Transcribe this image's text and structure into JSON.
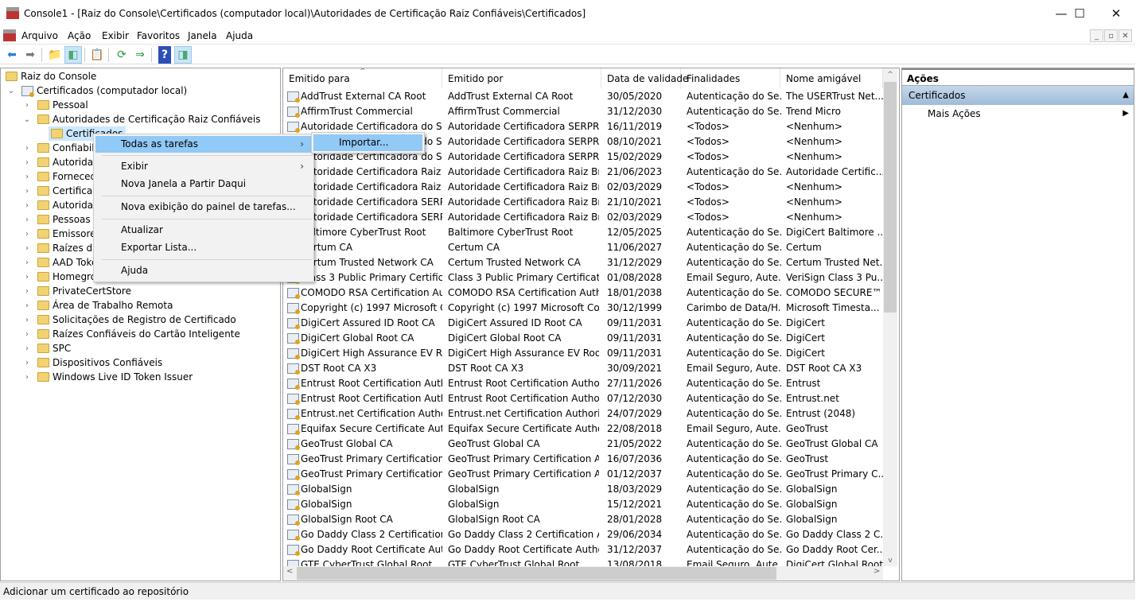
{
  "window": {
    "title": "Console1 - [Raiz do Console\\Certificados (computador local)\\Autoridades de Certificação Raiz Confiáveis\\Certificados]"
  },
  "menubar": [
    "Arquivo",
    "Ação",
    "Exibir",
    "Favoritos",
    "Janela",
    "Ajuda"
  ],
  "tree": {
    "root": "Raiz do Console",
    "computer": "Certificados (computador local)",
    "stores": [
      "Pessoal",
      "Autoridades de Certificação Raiz Confiáveis",
      "Confiabili",
      "Autoridad",
      "Fornecedo",
      "Certificad",
      "Autoridad",
      "Pessoas C",
      "Emissores",
      "Raízes da",
      "AAD Toke",
      "Homegro",
      "PrivateCertStore",
      "Área de Trabalho Remota",
      "Solicitações de Registro de Certificado",
      "Raízes Confiáveis do Cartão Inteligente",
      "SPC",
      "Dispositivos Confiáveis",
      "Windows Live ID Token Issuer"
    ],
    "selected": "Certificados"
  },
  "list": {
    "columns": [
      "Emitido para",
      "Emitido por",
      "Data de validade",
      "Finalidades",
      "Nome amigável"
    ],
    "rows": [
      [
        "AddTrust External CA Root",
        "AddTrust External CA Root",
        "30/05/2020",
        "Autenticação do Se...",
        "The USERTrust Net..."
      ],
      [
        "AffirmTrust Commercial",
        "AffirmTrust Commercial",
        "31/12/2030",
        "Autenticação do Se...",
        "Trend Micro"
      ],
      [
        "Autoridade Certificadora do SE...",
        "Autoridade Certificadora SERPRO ...",
        "16/11/2019",
        "<Todos>",
        "<Nenhum>"
      ],
      [
        "Autoridade Certificadora do SE...",
        "Autoridade Certificadora SERPRO ...",
        "08/10/2021",
        "<Todos>",
        "<Nenhum>"
      ],
      [
        "Autoridade Certificadora do SE...",
        "Autoridade Certificadora SERPRO ...",
        "15/02/2029",
        "<Todos>",
        "<Nenhum>"
      ],
      [
        "Autoridade Certificadora Raiz B...",
        "Autoridade Certificadora Raiz Bras...",
        "21/06/2023",
        "Autenticação do Se...",
        "Autoridade Certific..."
      ],
      [
        "Autoridade Certificadora Raiz B...",
        "Autoridade Certificadora Raiz Bras...",
        "02/03/2029",
        "<Todos>",
        "<Nenhum>"
      ],
      [
        "Autoridade Certificadora SERPR...",
        "Autoridade Certificadora Raiz Bras...",
        "21/10/2021",
        "<Todos>",
        "<Nenhum>"
      ],
      [
        "Autoridade Certificadora SERPR...",
        "Autoridade Certificadora Raiz Bras...",
        "02/03/2029",
        "<Todos>",
        "<Nenhum>"
      ],
      [
        "Baltimore CyberTrust Root",
        "Baltimore CyberTrust Root",
        "12/05/2025",
        "Autenticação do Se...",
        "DigiCert Baltimore ..."
      ],
      [
        "Certum CA",
        "Certum CA",
        "11/06/2027",
        "Autenticação do Se...",
        "Certum"
      ],
      [
        "Certum Trusted Network CA",
        "Certum Trusted Network CA",
        "31/12/2029",
        "Autenticação do Se...",
        "Certum Trusted Net..."
      ],
      [
        "Class 3 Public Primary Certificat...",
        "Class 3 Public Primary Certificatio...",
        "01/08/2028",
        "Email Seguro, Aute...",
        "VeriSign Class 3 Pu..."
      ],
      [
        "COMODO RSA Certification Au...",
        "COMODO RSA Certification Auth...",
        "18/01/2038",
        "Autenticação do Se...",
        "COMODO SECURE™"
      ],
      [
        "Copyright (c) 1997 Microsoft C...",
        "Copyright (c) 1997 Microsoft Corp.",
        "30/12/1999",
        "Carimbo de Data/H...",
        "Microsoft Timesta..."
      ],
      [
        "DigiCert Assured ID Root CA",
        "DigiCert Assured ID Root CA",
        "09/11/2031",
        "Autenticação do Se...",
        "DigiCert"
      ],
      [
        "DigiCert Global Root CA",
        "DigiCert Global Root CA",
        "09/11/2031",
        "Autenticação do Se...",
        "DigiCert"
      ],
      [
        "DigiCert High Assurance EV Ro...",
        "DigiCert High Assurance EV Root ...",
        "09/11/2031",
        "Autenticação do Se...",
        "DigiCert"
      ],
      [
        "DST Root CA X3",
        "DST Root CA X3",
        "30/09/2021",
        "Email Seguro, Aute...",
        "DST Root CA X3"
      ],
      [
        "Entrust Root Certification Auth...",
        "Entrust Root Certification Authority",
        "27/11/2026",
        "Autenticação do Se...",
        "Entrust"
      ],
      [
        "Entrust Root Certification Auth...",
        "Entrust Root Certification Authori...",
        "07/12/2030",
        "Autenticação do Se...",
        "Entrust.net"
      ],
      [
        "Entrust.net Certification Author...",
        "Entrust.net Certification Authority...",
        "24/07/2029",
        "Autenticação do Se...",
        "Entrust (2048)"
      ],
      [
        "Equifax Secure Certificate Auth...",
        "Equifax Secure Certificate Authority",
        "22/08/2018",
        "Email Seguro, Aute...",
        "GeoTrust"
      ],
      [
        "GeoTrust Global CA",
        "GeoTrust Global CA",
        "21/05/2022",
        "Autenticação do Se...",
        "GeoTrust Global CA"
      ],
      [
        "GeoTrust Primary Certification ...",
        "GeoTrust Primary Certification Au...",
        "16/07/2036",
        "Autenticação do Se...",
        "GeoTrust"
      ],
      [
        "GeoTrust Primary Certification ...",
        "GeoTrust Primary Certification Au...",
        "01/12/2037",
        "Autenticação do Se...",
        "GeoTrust Primary C..."
      ],
      [
        "GlobalSign",
        "GlobalSign",
        "18/03/2029",
        "Autenticação do Se...",
        "GlobalSign"
      ],
      [
        "GlobalSign",
        "GlobalSign",
        "15/12/2021",
        "Autenticação do Se...",
        "GlobalSign"
      ],
      [
        "GlobalSign Root CA",
        "GlobalSign Root CA",
        "28/01/2028",
        "Autenticação do Se...",
        "GlobalSign"
      ],
      [
        "Go Daddy Class 2 Certification ...",
        "Go Daddy Class 2 Certification Au...",
        "29/06/2034",
        "Autenticação do Se...",
        "Go Daddy Class 2 C..."
      ],
      [
        "Go Daddy Root Certificate Auth...",
        "Go Daddy Root Certificate Author...",
        "31/12/2037",
        "Autenticação do Se...",
        "Go Daddy Root Cer..."
      ],
      [
        "GTE CyberTrust Global Root",
        "GTE CyberTrust Global Root",
        "13/08/2018",
        "Email Seguro, Aute...",
        "DigiCert Global Root"
      ]
    ]
  },
  "actions": {
    "title": "Ações",
    "section": "Certificados",
    "more": "Mais Ações"
  },
  "context_menu": {
    "all_tasks": "Todas as tarefas",
    "view": "Exibir",
    "new_window": "Nova Janela a Partir Daqui",
    "new_taskpad": "Nova exibição do painel de tarefas...",
    "refresh": "Atualizar",
    "export": "Exportar Lista...",
    "help": "Ajuda",
    "submenu_import": "Importar..."
  },
  "status": "Adicionar um certificado ao repositório",
  "colors": {
    "menu_highlight": "#91c9f7",
    "actions_header": "#b7cfe6",
    "selection": "#cce8ff"
  }
}
